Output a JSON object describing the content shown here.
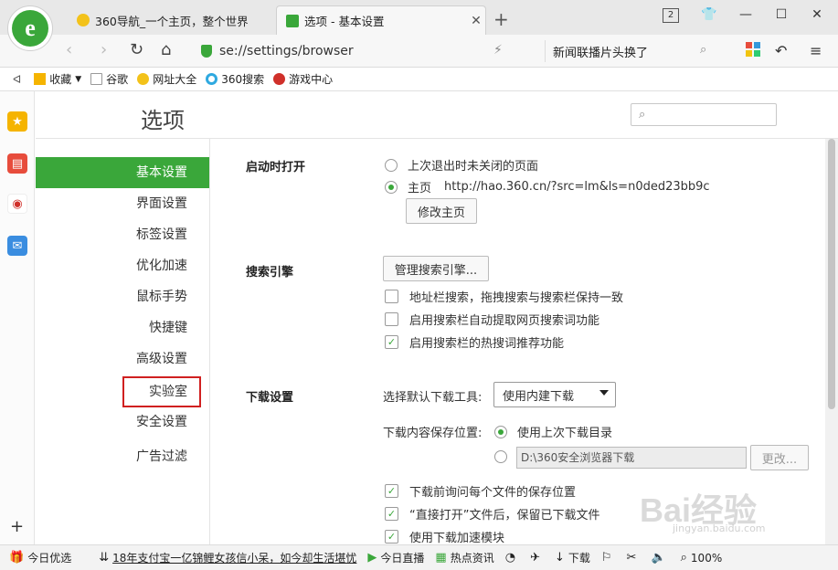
{
  "tabs": [
    {
      "label": "360导航_一个主页，整个世界",
      "active": false
    },
    {
      "label": "选项 - 基本设置",
      "active": true
    }
  ],
  "window": {
    "tab_count": "2"
  },
  "address": {
    "url": "se://settings/browser"
  },
  "search_bar": {
    "text": "新闻联播片头换了"
  },
  "bookmarks": [
    {
      "label": "收藏",
      "icon": "star-icon"
    },
    {
      "label": "谷歌",
      "icon": "page-icon"
    },
    {
      "label": "网址大全",
      "icon": "360-icon"
    },
    {
      "label": "360搜索",
      "icon": "360search-icon"
    },
    {
      "label": "游戏中心",
      "icon": "game-icon"
    }
  ],
  "settings": {
    "title": "选项",
    "categories": [
      {
        "label": "基本设置",
        "active": true
      },
      {
        "label": "界面设置"
      },
      {
        "label": "标签设置"
      },
      {
        "label": "优化加速"
      },
      {
        "label": "鼠标手势"
      },
      {
        "label": "快捷键"
      },
      {
        "label": "高级设置"
      },
      {
        "label": "实验室",
        "highlighted": true
      },
      {
        "label": "安全设置"
      },
      {
        "label": "广告过滤"
      }
    ],
    "startup": {
      "title": "启动时打开",
      "option_last": "上次退出时未关闭的页面",
      "option_home": "主页",
      "home_url": "http://hao.360.cn/?src=lm&ls=n0ded23bb9c",
      "change_home_button": "修改主页"
    },
    "search": {
      "title": "搜索引擎",
      "manage_button": "管理搜索引擎...",
      "options": [
        {
          "label": "地址栏搜索，拖拽搜索与搜索栏保持一致",
          "checked": false
        },
        {
          "label": "启用搜索栏自动提取网页搜索词功能",
          "checked": false
        },
        {
          "label": "启用搜索栏的热搜词推荐功能",
          "checked": true
        }
      ]
    },
    "download": {
      "title": "下载设置",
      "tool_label": "选择默认下载工具:",
      "tool_value": "使用内建下载",
      "location_label": "下载内容保存位置:",
      "location_last": "使用上次下载目录",
      "location_path": "D:\\360安全浏览器下载",
      "change_button": "更改...",
      "options": [
        {
          "label": "下载前询问每个文件的保存位置",
          "checked": true
        },
        {
          "label": "“直接打开”文件后，保留已下载文件",
          "checked": true
        },
        {
          "label": "使用下载加速模块",
          "checked": true
        }
      ]
    }
  },
  "statusbar": {
    "today_pick": "今日优选",
    "news": "18年支付宝一亿锦鲤女孩信小呆，如今却生活堪忧",
    "live": "今日直播",
    "hot": "热点资讯",
    "download": "下载",
    "zoom": "100%"
  },
  "watermark": {
    "text": "Bai经验",
    "sub": "jingyan.baidu.com"
  },
  "colors": {
    "accent": "#3aa73a",
    "highlight_box": "#d02020"
  }
}
